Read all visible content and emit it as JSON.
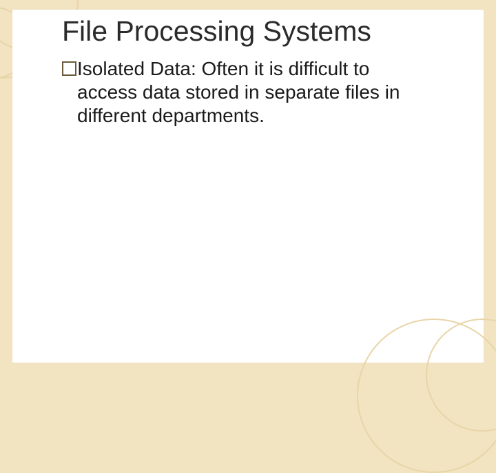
{
  "slide": {
    "title": "File Processing Systems",
    "bullet": {
      "lead": "Isolated Data:",
      "rest_first_line": " Often it is difficult to",
      "cont": "access data stored in separate files in different departments."
    }
  }
}
